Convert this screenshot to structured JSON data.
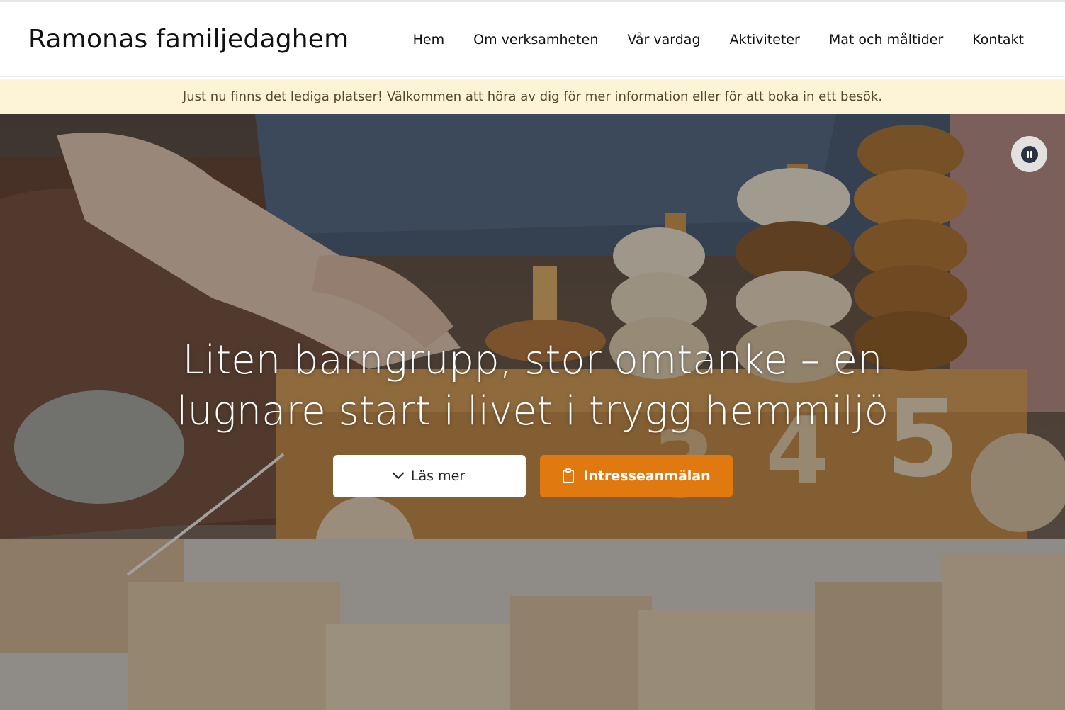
{
  "header": {
    "logo": "Ramonas familjedaghem",
    "nav": [
      "Hem",
      "Om verksamheten",
      "Vår vardag",
      "Aktiviteter",
      "Mat och måltider",
      "Kontakt"
    ]
  },
  "notice": {
    "text": "Just nu finns det lediga platser! Välkommen att höra av dig för mer information eller för att boka in ett besök."
  },
  "hero": {
    "headline_line1": "Liten barngrupp, stor omtanke – en",
    "headline_line2": "lugnare start i livet i trygg hemmiljö",
    "read_more_label": "Läs mer",
    "apply_label": "Intresseanmälan",
    "pause_icon": "pause-icon",
    "read_more_icon": "chevron-down-icon",
    "apply_icon": "clipboard-icon"
  },
  "colors": {
    "accent": "#e07a10",
    "notice_bg": "#fdf3d6",
    "notice_text": "#5a4630"
  }
}
